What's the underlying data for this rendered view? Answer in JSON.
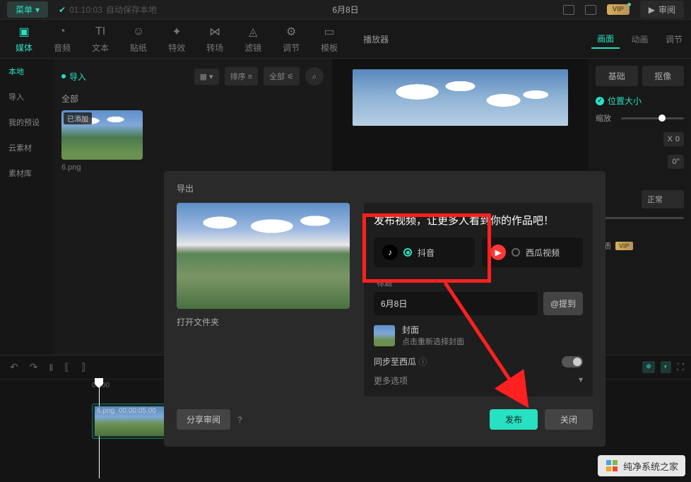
{
  "topbar": {
    "menu_label": "菜单",
    "autosave_time": "01:10:03",
    "autosave_text": "自动保存本地",
    "project_title": "6月8日",
    "vip_label": "VIP",
    "review_label": "审阅"
  },
  "tooltabs": [
    {
      "icon": "▣",
      "label": "媒体"
    },
    {
      "icon": "◔",
      "label": "音频"
    },
    {
      "icon": "TI",
      "label": "文本"
    },
    {
      "icon": "☺",
      "label": "贴纸"
    },
    {
      "icon": "✦",
      "label": "特效"
    },
    {
      "icon": "⋈",
      "label": "转场"
    },
    {
      "icon": "◬",
      "label": "滤镜"
    },
    {
      "icon": "⚙",
      "label": "调节"
    },
    {
      "icon": "▭",
      "label": "模板"
    }
  ],
  "player_header": "播放器",
  "sidebar": {
    "items": [
      "本地",
      "导入",
      "我的预设",
      "云素材",
      "素材库"
    ]
  },
  "media": {
    "import_label": "导入",
    "sort_label": "排序",
    "all_label": "全部",
    "category": "全部",
    "thumb_badge": "已添加",
    "thumb_name": "6.png"
  },
  "right_tabs": [
    "画面",
    "动画",
    "调节"
  ],
  "right_subtabs": [
    "基础",
    "抠像"
  ],
  "right_panel": {
    "position_size": "位置大小",
    "scale_label": "缩放",
    "x_label": "X",
    "x_value": "0",
    "rotation_value": "0°",
    "blend_label": "正常",
    "quality_label": "画质"
  },
  "timeline": {
    "start_time": "00:00",
    "clip_name": "6.png",
    "clip_duration": "00:00:05:00"
  },
  "modal": {
    "title": "导出",
    "open_folder": "打开文件夹",
    "publish_heading": "发布视频，让更多人看到你的作品吧！",
    "douyin_label": "抖音",
    "xigua_label": "西瓜视频",
    "title_field_label": "标题",
    "title_value": "6月8日",
    "at_button": "@提到",
    "cover_label": "封面",
    "cover_hint": "点击重新选择封面",
    "sync_label": "同步至西瓜",
    "more_options": "更多选项",
    "share_review": "分享审阅",
    "publish_btn": "发布",
    "close_btn": "关闭"
  },
  "watermark": {
    "text": "纯净系统之家"
  }
}
